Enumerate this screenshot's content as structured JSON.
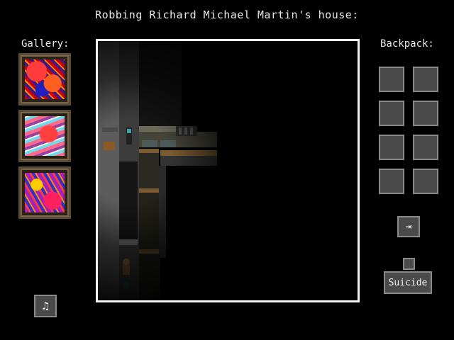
{
  "title": "Robbing Richard Michael Martin's house:",
  "gallery": {
    "label": "Gallery:",
    "paintings": [
      {
        "icon": "painting-red-abstract"
      },
      {
        "icon": "painting-pink-cyan-abstract"
      },
      {
        "icon": "painting-purple-yellow-abstract"
      }
    ]
  },
  "backpack": {
    "label": "Backpack:",
    "slots": [
      "",
      "",
      "",
      "",
      "",
      "",
      "",
      ""
    ]
  },
  "controls": {
    "exit_icon": "exit-arrow-icon",
    "exit_glyph": "⇥",
    "suicide_label": "Suicide",
    "music_icon": "music-note-icon",
    "music_glyph": "♫"
  },
  "colors": {
    "background": "#000000",
    "viewport_border": "#f2f2f2",
    "button_fill": "#4a4a4a",
    "button_border": "#8a8a8a",
    "frame_wood": "#5a4a33"
  }
}
